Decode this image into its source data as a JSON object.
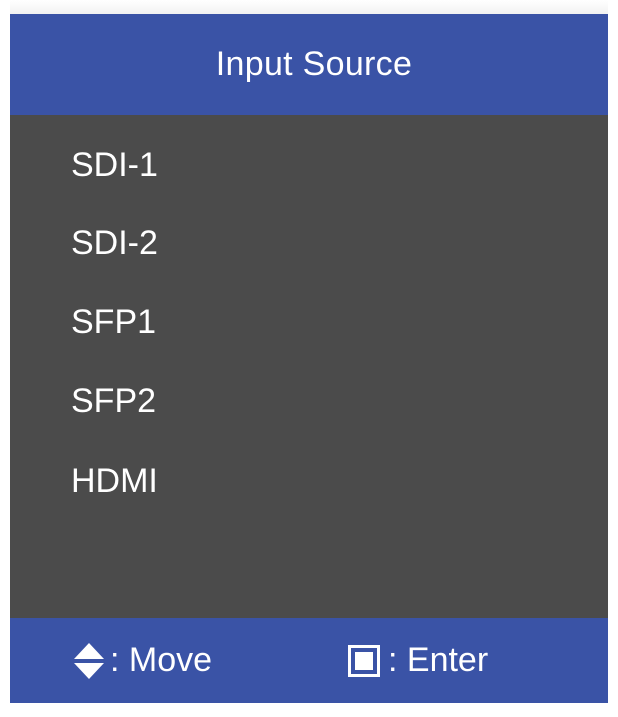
{
  "osd": {
    "title": "Input Source",
    "items": [
      {
        "label": "SDI-1"
      },
      {
        "label": "SDI-2"
      },
      {
        "label": "SFP1"
      },
      {
        "label": "SFP2"
      },
      {
        "label": "HDMI"
      }
    ],
    "footer": {
      "move_icon": "up-down-arrows-icon",
      "move_label": ": Move",
      "enter_icon": "enter-square-icon",
      "enter_label": ": Enter"
    }
  },
  "colors": {
    "header_footer": "#3a53a6",
    "panel": "#4b4b4b",
    "text": "#ffffff"
  }
}
